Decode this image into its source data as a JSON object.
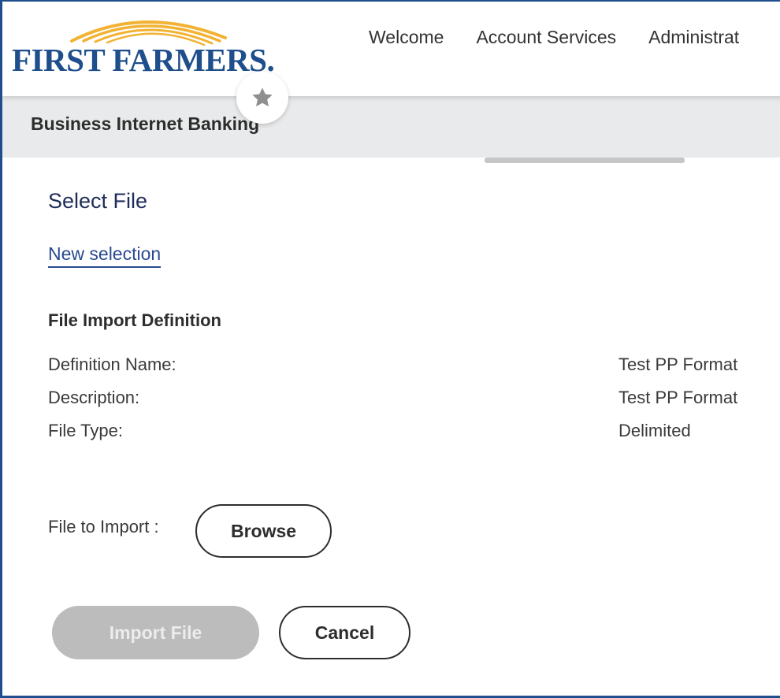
{
  "brand": {
    "name": "FIRST FARMERS.",
    "primary_color": "#1f4e8c",
    "accent_color": "#f2b233"
  },
  "nav": {
    "items": [
      "Welcome",
      "Account Services",
      "Administrat"
    ]
  },
  "favorite": {
    "icon": "star-icon"
  },
  "subheader": {
    "title": "Business Internet Banking"
  },
  "page": {
    "title": "Select File",
    "new_selection_link": "New selection",
    "definition_heading": "File Import Definition",
    "definition": [
      {
        "label": "Definition Name:",
        "value": "Test PP Format"
      },
      {
        "label": "Description:",
        "value": "Test PP Format"
      },
      {
        "label": "File Type:",
        "value": "Delimited"
      }
    ],
    "file_to_import_label": "File to Import :",
    "browse_label": "Browse",
    "import_label": "Import File",
    "cancel_label": "Cancel"
  }
}
